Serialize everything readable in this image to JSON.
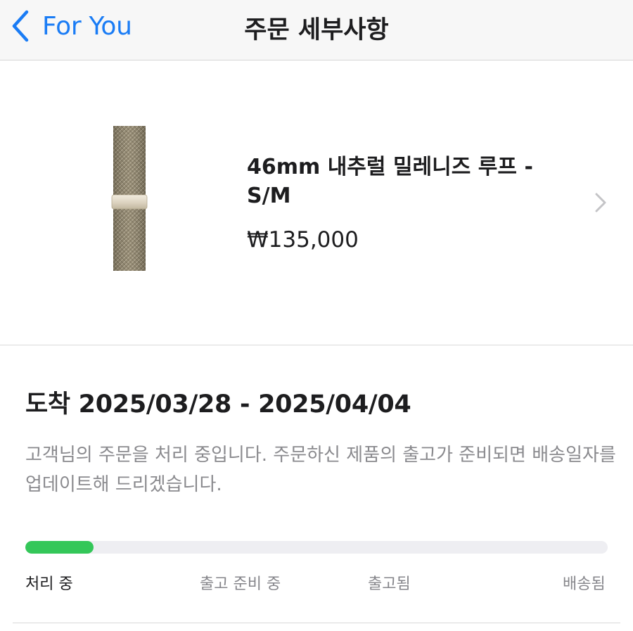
{
  "nav": {
    "back_label": "For You",
    "title": "주문 세부사항"
  },
  "product": {
    "name": "46mm 내추럴 밀레니즈 루프 - S/M",
    "price": "₩135,000",
    "image_icon": "milanese-loop-band-image"
  },
  "delivery": {
    "title": "도착 2025/03/28 - 2025/04/04",
    "description": "고객님의 주문을 처리 중입니다. 주문하신 제품의 출고가 준비되면 배송일자를 업데이트해 드리겠습니다.",
    "progress": 0.117,
    "steps": [
      "처리 중",
      "출고 준비 중",
      "출고됨",
      "배송됨"
    ],
    "active_step": 0
  },
  "colors": {
    "accent": "#1a7cf5",
    "progress_fill": "#34c759",
    "progress_track": "#eeeef2",
    "secondary_text": "#8a8a8e"
  }
}
